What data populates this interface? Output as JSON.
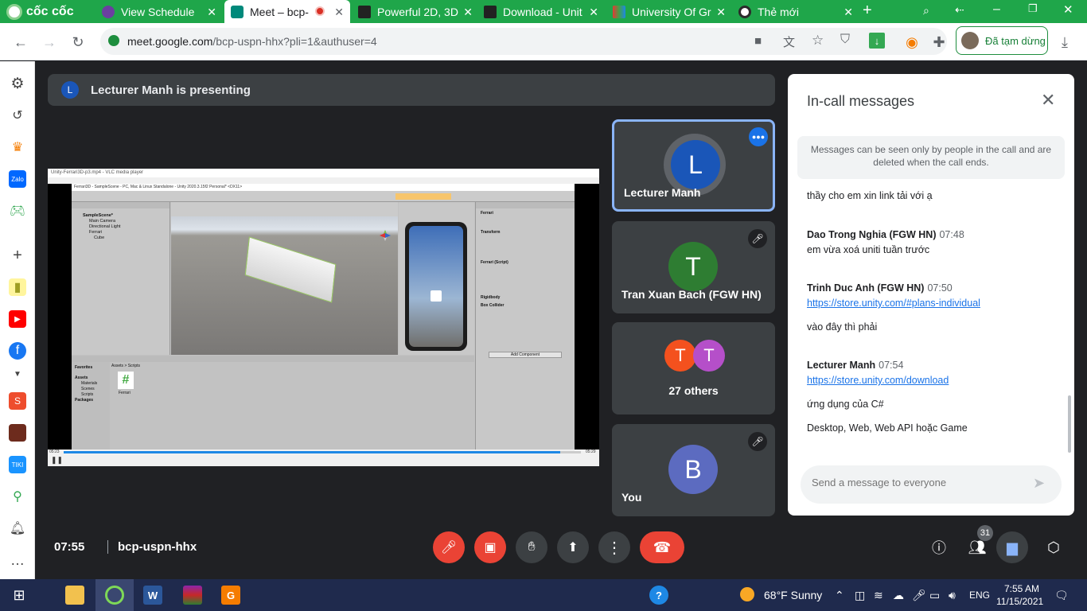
{
  "browser": {
    "brand": "cốc cốc",
    "tabs": [
      {
        "title": "View Schedule",
        "icon": "globe-icon"
      },
      {
        "title": "Meet – bcp-",
        "icon": "meet-icon",
        "recording": true
      },
      {
        "title": "Powerful 2D, 3D",
        "icon": "unity-icon"
      },
      {
        "title": "Download - Unit",
        "icon": "unity-icon"
      },
      {
        "title": "University Of Gr",
        "icon": "university-icon"
      },
      {
        "title": "Thẻ mới",
        "icon": "new-tab-icon"
      }
    ],
    "url_domain": "meet.google.com",
    "url_path": "/bcp-uspn-hhx?pli=1&authuser=4",
    "profile_label": "Đã tạm dừng"
  },
  "meet": {
    "presenting_avatar": "L",
    "presenting_text": "Lecturer Manh is presenting",
    "participants": [
      {
        "name": "Lecturer Manh",
        "initial": "L",
        "color": "#1a56b8",
        "speaking": true
      },
      {
        "name": "Tran Xuan Bach (FGW HN)",
        "initial": "T",
        "color": "#2e7d32",
        "muted": true
      },
      {
        "name": "27 others",
        "initials": [
          "T",
          "T"
        ],
        "colors": [
          "#f4511e",
          "#b54fc9"
        ]
      },
      {
        "name": "You",
        "initial": "B",
        "color": "#5c6bc0",
        "muted": true
      }
    ],
    "clock": "07:55",
    "meeting_code": "bcp-uspn-hhx",
    "people_count": "31"
  },
  "chat": {
    "title": "In-call messages",
    "note": "Messages can be seen only by people in the call and are deleted when the call ends.",
    "messages": [
      {
        "text": "thầy cho em xin link tải với ạ"
      },
      {
        "sender": "Dao Trong Nghia (FGW HN)",
        "time": "07:48",
        "text": "em vừa xoá uniti tuần trước"
      },
      {
        "sender": "Trinh Duc Anh (FGW HN)",
        "time": "07:50",
        "link": "https://store.unity.com/#plans-individual",
        "text": "vào đây thì phải"
      },
      {
        "sender": "Lecturer Manh",
        "time": "07:54",
        "link": "https://store.unity.com/download",
        "text": "ứng dụng của C#",
        "text2": "Desktop, Web, Web API hoặc Game"
      }
    ],
    "input_placeholder": "Send a message to everyone"
  },
  "shared_screen": {
    "vlc_title": "Unity-Ferrari3D-p3.mp4 - VLC media player",
    "unity_title": "Ferrari3D - SampleScene - PC, Mac & Linux Standalone - Unity 2020.3.15f2 Personal* <DX11>",
    "hierarchy": [
      "SampleScene*",
      "Main Camera",
      "Directional Light",
      "Ferrari",
      "Cube"
    ],
    "inspector_object": "Ferrari",
    "components": [
      "Transform",
      "Ferrari (Script)",
      "Rigidbody",
      "Box Collider"
    ],
    "add_component": "Add Component",
    "project_folders": [
      "Favorites",
      "Assets",
      "Materials",
      "Scenes",
      "Scripts",
      "Packages"
    ],
    "script_name": "Ferrari",
    "project_breadcrumb": "Assets > Scripts",
    "vlc_time_left": "05:23",
    "vlc_time_right": "05:29"
  },
  "taskbar": {
    "weather": "68°F  Sunny",
    "language": "ENG",
    "time": "7:55 AM",
    "date": "11/15/2021"
  }
}
